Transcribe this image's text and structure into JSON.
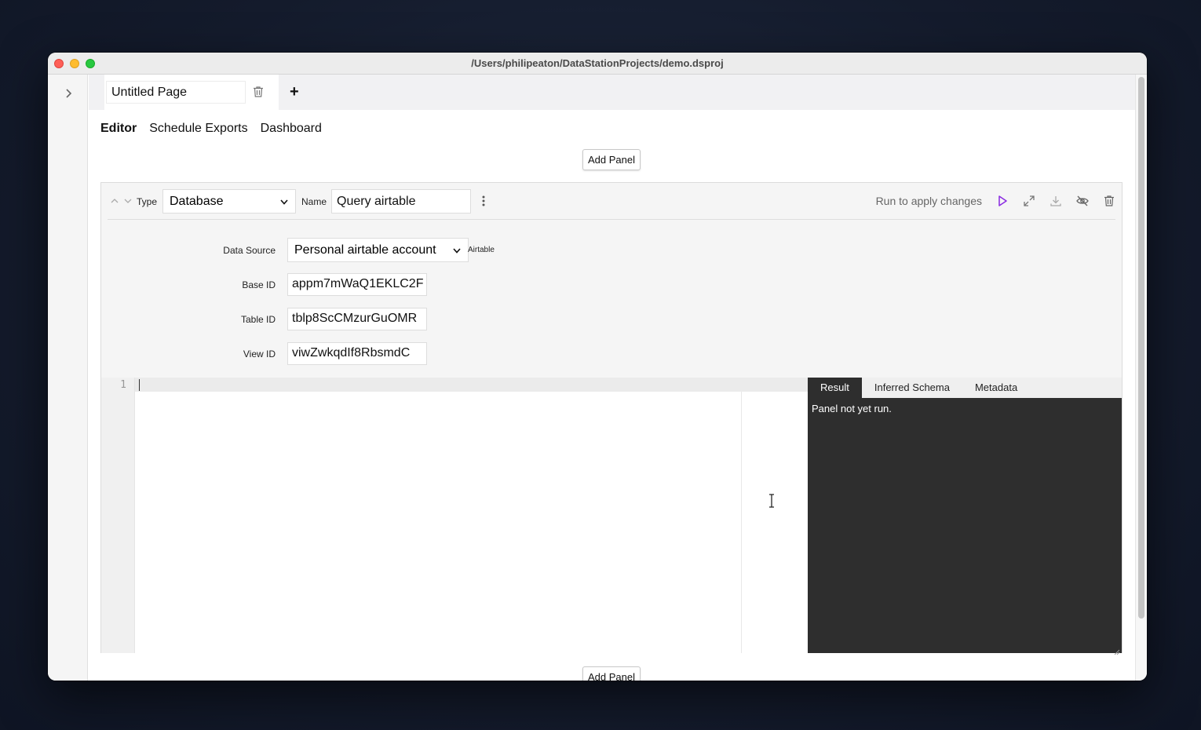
{
  "window": {
    "title": "/Users/philipeaton/DataStationProjects/demo.dsproj"
  },
  "sidebar": {
    "toggle_icon": "chevron-right-icon"
  },
  "pagebar": {
    "page_name": "Untitled Page",
    "add_label": "+"
  },
  "nav": {
    "tabs": [
      {
        "label": "Editor",
        "active": true
      },
      {
        "label": "Schedule Exports",
        "active": false
      },
      {
        "label": "Dashboard",
        "active": false
      }
    ]
  },
  "toolbar": {
    "add_panel_label": "Add Panel"
  },
  "panel": {
    "type_label": "Type",
    "type_value": "Database",
    "name_label": "Name",
    "name_value": "Query airtable",
    "run_hint": "Run to apply changes",
    "fields": {
      "data_source_label": "Data Source",
      "data_source_value": "Personal airtable account",
      "data_source_tag": "Airtable",
      "base_id_label": "Base ID",
      "base_id_value": "appm7mWaQ1EKLC2F",
      "table_id_label": "Table ID",
      "table_id_value": "tblp8ScCMzurGuOMR",
      "view_id_label": "View ID",
      "view_id_value": "viwZwkqdIf8RbsmdC"
    },
    "editor": {
      "line_number": "1"
    },
    "result": {
      "tabs": [
        "Result",
        "Inferred Schema",
        "Metadata"
      ],
      "active_tab": "Result",
      "message": "Panel not yet run."
    }
  },
  "colors": {
    "run_accent": "#8a2be2",
    "result_bg": "#2e2e2e"
  }
}
